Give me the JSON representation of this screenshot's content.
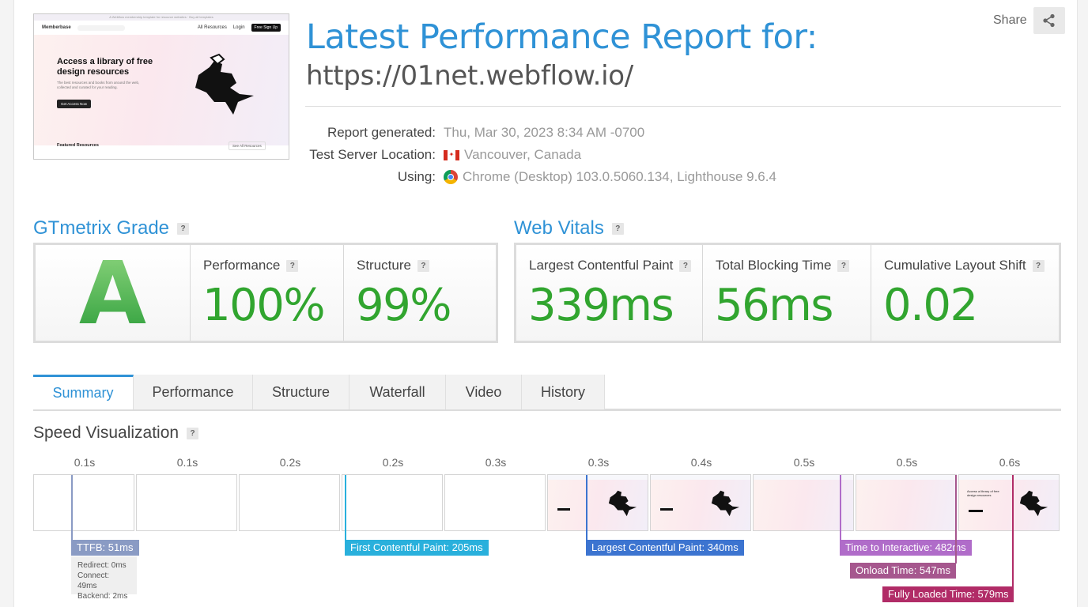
{
  "thumbnail": {
    "banner": "A Webflow membership template for resource websites · Buy all templates",
    "logo": "Memberbase",
    "nav_links": [
      "All Resources",
      "Login"
    ],
    "nav_button": "Free Sign Up",
    "hero_title": "Access a library of free design resources",
    "hero_text": "The best resources and books from around the web, collected and curated for your reading.",
    "hero_cta": "Get Access Now",
    "featured": "Featured Resources",
    "see_all": "See All Resources"
  },
  "header": {
    "title": "Latest Performance Report for:",
    "url": "https://01net.webflow.io/",
    "share_label": "Share"
  },
  "meta": {
    "report_generated_label": "Report generated:",
    "report_generated_value": "Thu, Mar 30, 2023 8:34 AM -0700",
    "server_label": "Test Server Location:",
    "server_value": "Vancouver, Canada",
    "using_label": "Using:",
    "using_value": "Chrome (Desktop) 103.0.5060.134, Lighthouse 9.6.4"
  },
  "grade": {
    "heading": "GTmetrix Grade",
    "letter": "A",
    "performance_label": "Performance",
    "performance_value": "100%",
    "structure_label": "Structure",
    "structure_value": "99%"
  },
  "vitals": {
    "heading": "Web Vitals",
    "lcp_label": "Largest Contentful Paint",
    "lcp_value": "339ms",
    "tbt_label": "Total Blocking Time",
    "tbt_value": "56ms",
    "cls_label": "Cumulative Layout Shift",
    "cls_value": "0.02"
  },
  "tabs": [
    "Summary",
    "Performance",
    "Structure",
    "Waterfall",
    "Video",
    "History"
  ],
  "speed": {
    "heading": "Speed Visualization",
    "ticks": [
      "0.1s",
      "0.1s",
      "0.2s",
      "0.2s",
      "0.3s",
      "0.3s",
      "0.4s",
      "0.5s",
      "0.5s",
      "0.6s"
    ],
    "ttfb": "TTFB: 51ms",
    "redirect": "Redirect: 0ms",
    "connect": "Connect: 49ms",
    "backend": "Backend: 2ms",
    "fcp": "First Contentful Paint: 205ms",
    "lcp": "Largest Contentful Paint: 340ms",
    "tti": "Time to Interactive: 482ms",
    "onload": "Onload Time: 547ms",
    "fully_loaded": "Fully Loaded Time: 579ms"
  },
  "colors": {
    "accent": "#2f92d6",
    "good": "#31a52f",
    "ttfb": "#8a9bc4",
    "fcp": "#29b0dc",
    "lcp": "#3c74d0",
    "tti": "#b06cc9",
    "onload": "#a6578e",
    "fully_loaded": "#b12c67"
  }
}
